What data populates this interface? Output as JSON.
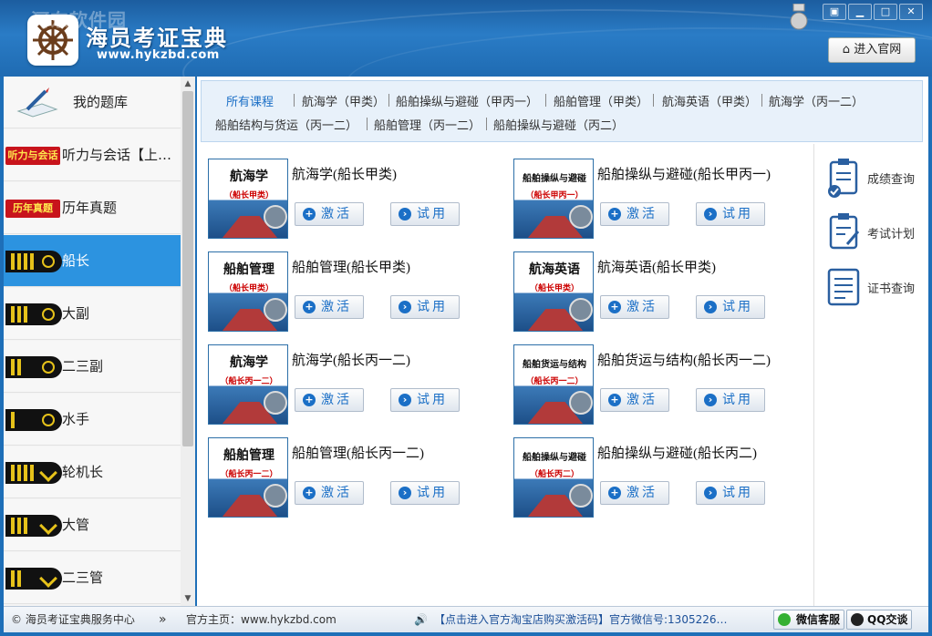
{
  "header": {
    "watermark": "河东软件园",
    "app_name": "海员考证宝典",
    "url": "www.hykzbd.com",
    "window_buttons": [
      "pin-icon",
      "minimize-icon",
      "maximize-icon",
      "close-icon"
    ],
    "website_button": "进入官网"
  },
  "sidebar": {
    "items": [
      {
        "label": "我的题库",
        "icon": "quiz-pencil-icon"
      },
      {
        "label": "听力与会话【上…",
        "icon": "badge",
        "badge": "听力与会话"
      },
      {
        "label": "历年真题",
        "icon": "badge",
        "badge": "历年真题"
      },
      {
        "label": "船长",
        "icon": "epaulette-4-stripes-icon",
        "active": true
      },
      {
        "label": "大副",
        "icon": "epaulette-3-stripes-icon"
      },
      {
        "label": "二三副",
        "icon": "epaulette-2-stripes-icon"
      },
      {
        "label": "水手",
        "icon": "epaulette-1-stripe-icon"
      },
      {
        "label": "轮机长",
        "icon": "engine-epaulette-4-stripes-icon"
      },
      {
        "label": "大管",
        "icon": "engine-epaulette-3-stripes-icon"
      },
      {
        "label": "二三管",
        "icon": "engine-epaulette-2-stripes-icon"
      }
    ]
  },
  "course_tabs": [
    "所有课程",
    "航海学（甲类）",
    "船舶操纵与避碰（甲丙一）",
    "船舶管理（甲类）",
    "航海英语（甲类）",
    "航海学（丙一二）",
    "船舶结构与货运（丙一二）",
    "船舶管理（丙一二）",
    "船舶操纵与避碰（丙二）"
  ],
  "courses": [
    {
      "cover_title": "航海学",
      "cover_sub": "（船长甲类）",
      "title": "航海学(船长甲类)"
    },
    {
      "cover_title": "船舶操纵与避碰",
      "cover_sub": "（船长甲丙一）",
      "title": "船舶操纵与避碰(船长甲丙一)"
    },
    {
      "cover_title": "船舶管理",
      "cover_sub": "（船长甲类）",
      "title": "船舶管理(船长甲类)"
    },
    {
      "cover_title": "航海英语",
      "cover_sub": "（船长甲类）",
      "title": "航海英语(船长甲类)"
    },
    {
      "cover_title": "航海学",
      "cover_sub": "（船长丙一二）",
      "title": "航海学(船长丙一二)"
    },
    {
      "cover_title": "船舶货运与结构",
      "cover_sub": "（船长丙一二）",
      "title": "船舶货运与结构(船长丙一二)"
    },
    {
      "cover_title": "船舶管理",
      "cover_sub": "（船长丙一二）",
      "title": "船舶管理(船长丙一二)"
    },
    {
      "cover_title": "船舶操纵与避碰",
      "cover_sub": "（船长丙二）",
      "title": "船舶操纵与避碰(船长丙二)"
    }
  ],
  "buttons": {
    "activate": "激活",
    "trial": "试用"
  },
  "right_panel": [
    {
      "label": "成绩查询",
      "icon": "score-clipboard-icon"
    },
    {
      "label": "考试计划",
      "icon": "plan-clipboard-icon"
    },
    {
      "label": "证书查询",
      "icon": "certificate-icon"
    }
  ],
  "status": {
    "copyright": "© 海员考证宝典服务中心",
    "more": "»",
    "homepage": "官方主页：www.hykzbd.com",
    "promo": "【点击进入官方淘宝店购买激活码】官方微信号:1305226…",
    "wechat": "微信客服",
    "qq": "QQ交谈"
  }
}
